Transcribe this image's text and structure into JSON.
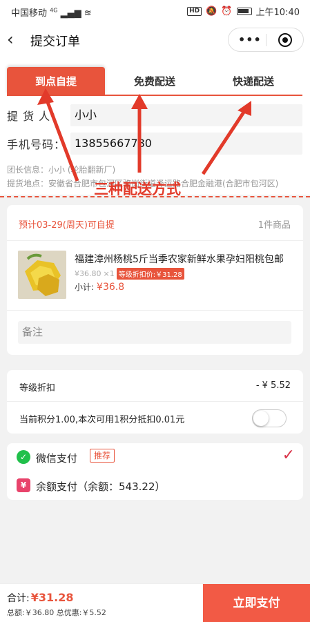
{
  "status_bar": {
    "carrier": "中国移动",
    "network": "4G",
    "time": "上午10:40",
    "hd": "HD"
  },
  "nav": {
    "title": "提交订单"
  },
  "tabs": [
    {
      "label": "到点自提",
      "active": true
    },
    {
      "label": "免费配送",
      "active": false
    },
    {
      "label": "快递配送",
      "active": false
    }
  ],
  "form": {
    "pickup_label": "提 货 人：",
    "pickup_value": "小小",
    "phone_label": "手机号码：",
    "phone_value": "13855667780"
  },
  "leader_info": "团长信息：小小 (轮胎翻新厂)",
  "pickup_address": "提货地点：安徽省合肥市包河区骆岗街道泽远路合肥金融港(合肥市包河区)",
  "annotation": "三种配送方式",
  "order": {
    "estimate": "预计03-29(周天)可自提",
    "item_count": "1件商品",
    "product_name": "福建漳州杨桃5斤当季农家新鲜水果孕妇阳桃包邮",
    "unit_price": "¥36.80",
    "qty": "×1",
    "badge": "等级折扣价:￥31.28",
    "subtotal_label": "小计:",
    "subtotal_value": "¥36.8",
    "remark_placeholder": "备注"
  },
  "discounts": {
    "level_label": "等级折扣",
    "level_value": "- ¥ 5.52",
    "points_label": "当前积分1.00,本次可用1积分抵扣0.01元",
    "points_enabled": false
  },
  "payment": {
    "wechat_label": "微信支付",
    "recommend": "推荐",
    "check": "✓",
    "balance_label": "余额支付（余额：543.22）",
    "balance_icon": "¥"
  },
  "footer": {
    "total_label": "合计:",
    "total_value": "¥31.28",
    "breakdown": "总额:￥36.80    总优惠:￥5.52",
    "pay_button": "立即支付"
  },
  "colors": {
    "accent": "#e8543c",
    "annotation": "#e23a2a",
    "wechat": "#21c04b",
    "balance": "#e8436b"
  }
}
